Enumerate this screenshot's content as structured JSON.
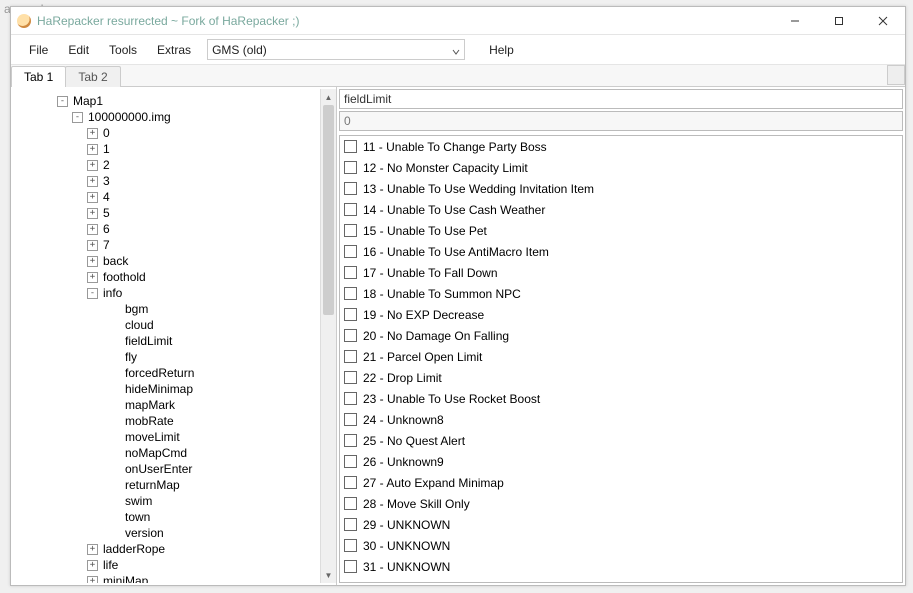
{
  "bg_tab": {
    "label": "arepacker.res",
    "close_glyph": "×"
  },
  "title": "HaRepacker resurrected  ~ Fork of HaRepacker ;)",
  "menus": {
    "file": "File",
    "edit": "Edit",
    "tools": "Tools",
    "extras": "Extras",
    "help": "Help"
  },
  "version_combo": {
    "selected": "GMS (old)"
  },
  "tabs": [
    "Tab 1",
    "Tab 2"
  ],
  "active_tab": 0,
  "tree": {
    "root": "Map1",
    "img": "100000000.img",
    "nums": [
      "0",
      "1",
      "2",
      "3",
      "4",
      "5",
      "6",
      "7"
    ],
    "folders_before_info": [
      "back",
      "foothold"
    ],
    "info": "info",
    "info_children": [
      "bgm",
      "cloud",
      "fieldLimit",
      "fly",
      "forcedReturn",
      "hideMinimap",
      "mapMark",
      "mobRate",
      "moveLimit",
      "noMapCmd",
      "onUserEnter",
      "returnMap",
      "swim",
      "town",
      "version"
    ],
    "folders_after_info": [
      "ladderRope",
      "life",
      "miniMap"
    ]
  },
  "detail": {
    "name": "fieldLimit",
    "value": "0"
  },
  "flags": [
    "11 - Unable To Change Party Boss",
    "12 - No Monster Capacity Limit",
    "13 - Unable To Use Wedding Invitation Item",
    "14 - Unable To Use Cash Weather",
    "15 - Unable To Use Pet",
    "16 - Unable To Use AntiMacro Item",
    "17 - Unable To Fall Down",
    "18 - Unable To Summon NPC",
    "19 - No EXP Decrease",
    "20 - No Damage On Falling",
    "21 - Parcel Open Limit",
    "22 - Drop Limit",
    "23 - Unable To Use Rocket Boost",
    "24 - Unknown8",
    "25 - No Quest Alert",
    "26 - Unknown9",
    "27 - Auto Expand Minimap",
    "28 - Move Skill Only",
    "29 - UNKNOWN",
    "30 - UNKNOWN",
    "31 - UNKNOWN"
  ]
}
